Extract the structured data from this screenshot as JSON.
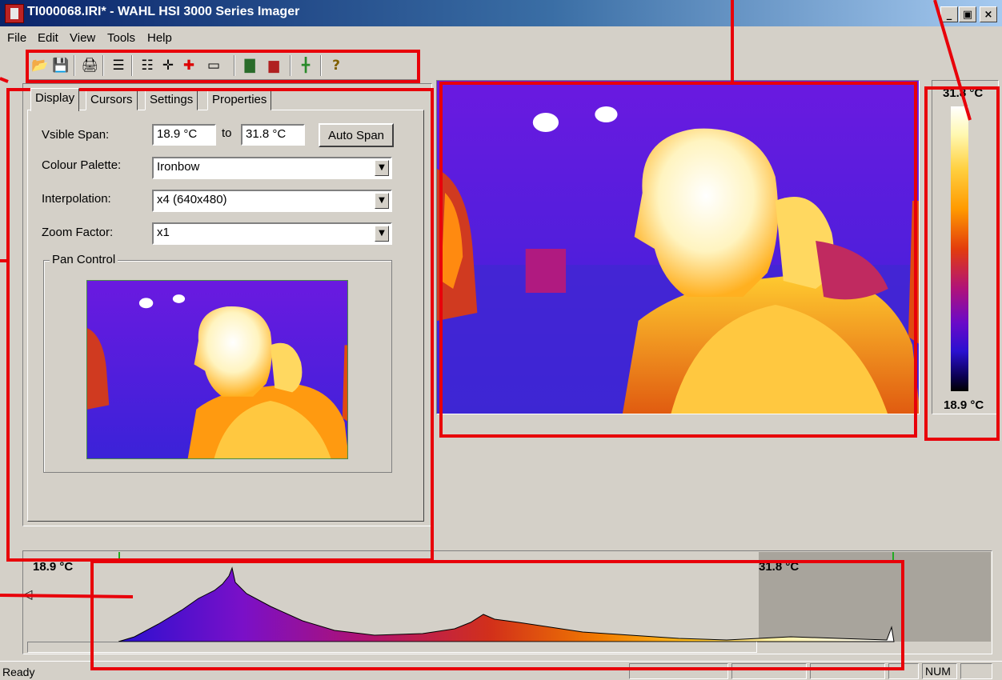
{
  "window": {
    "title": "TI000068.IRI* - WAHL HSI 3000 Series Imager",
    "minimize": "_",
    "maximize": "▣",
    "close": "×"
  },
  "menu": [
    "File",
    "Edit",
    "View",
    "Tools",
    "Help"
  ],
  "toolbar": {
    "buttons": [
      {
        "name": "open-icon",
        "glyph": "📂"
      },
      {
        "name": "save-icon",
        "glyph": "💾"
      },
      {
        "name": "print-icon",
        "glyph": "🖨"
      },
      {
        "name": "properties-icon",
        "glyph": "☰"
      },
      {
        "name": "report-icon",
        "glyph": "☷"
      },
      {
        "name": "crosshair-icon",
        "glyph": "✛"
      },
      {
        "name": "color-crosshair-icon",
        "glyph": "✚"
      },
      {
        "name": "rectangle-icon",
        "glyph": "▭"
      },
      {
        "name": "histogram-icon",
        "glyph": "▇"
      },
      {
        "name": "histogram-red-icon",
        "glyph": "▆"
      },
      {
        "name": "grid-icon",
        "glyph": "╋"
      },
      {
        "name": "help-icon",
        "glyph": "?"
      }
    ]
  },
  "tabs": [
    {
      "label": "Display",
      "active": true
    },
    {
      "label": "Cursors"
    },
    {
      "label": "Settings"
    },
    {
      "label": "Properties"
    }
  ],
  "display": {
    "visible_span_label": "Vsible Span:",
    "span_min": "18.9 °C",
    "to_label": "to",
    "span_max": "31.8 °C",
    "auto_span_button": "Auto Span",
    "colour_palette_label": "Colour Palette:",
    "colour_palette_value": "Ironbow",
    "interpolation_label": "Interpolation:",
    "interpolation_value": "x4 (640x480)",
    "zoom_factor_label": "Zoom Factor:",
    "zoom_factor_value": "x1",
    "pan_control_label": "Pan Control"
  },
  "colors": {
    "annotation": "#e8000a",
    "background": "#5a1ce0"
  },
  "scale": {
    "max": "31.8 °C",
    "min": "18.9 °C"
  },
  "histogram": {
    "min_label": "18.9 °C",
    "max_label": "31.8 °C"
  },
  "status": {
    "text": "Ready",
    "num": "NUM"
  }
}
